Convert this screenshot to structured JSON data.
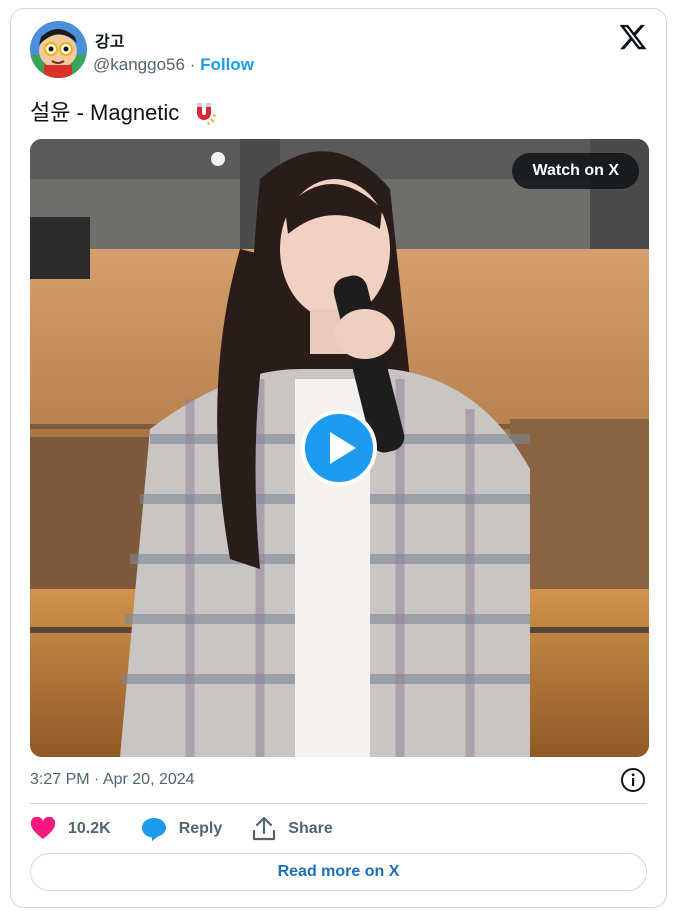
{
  "author": {
    "name": "강고",
    "handle": "@kanggo56",
    "separator": "·",
    "follow_label": "Follow"
  },
  "tweet": {
    "text": "설윤 - Magnetic",
    "emoji_icon": "magnet-icon",
    "timestamp": "3:27 PM · Apr 20, 2024"
  },
  "media": {
    "watch_label": "Watch on X",
    "play_icon": "play-icon"
  },
  "actions": {
    "like_count": "10.2K",
    "reply_label": "Reply",
    "share_label": "Share"
  },
  "footer": {
    "read_more_label": "Read more on X"
  },
  "colors": {
    "accent": "#1d9bf0",
    "like": "#f91880",
    "border": "#cfd9de",
    "muted_text": "#536471"
  }
}
